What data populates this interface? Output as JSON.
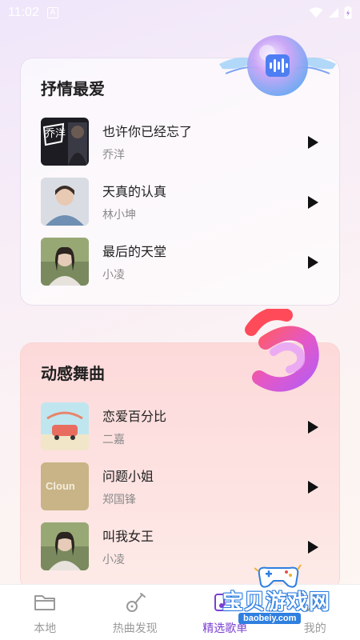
{
  "status": {
    "time": "11:02",
    "badge_letter": "A"
  },
  "sections": [
    {
      "title": "抒情最爱",
      "songs": [
        {
          "title": "也许你已经忘了",
          "artist": "乔洋",
          "cover_text": "乔洋"
        },
        {
          "title": "天真的认真",
          "artist": "林小坤"
        },
        {
          "title": "最后的天堂",
          "artist": "小凌"
        }
      ]
    },
    {
      "title": "动感舞曲",
      "songs": [
        {
          "title": "恋爱百分比",
          "artist": "二嘉"
        },
        {
          "title": "问题小姐",
          "artist": "郑国锋",
          "cover_text": "Cloun"
        },
        {
          "title": "叫我女王",
          "artist": "小凌"
        }
      ]
    }
  ],
  "tabs": [
    {
      "label": "本地",
      "icon": "folder-icon",
      "active": false
    },
    {
      "label": "热曲发现",
      "icon": "guitar-icon",
      "active": false
    },
    {
      "label": "精选歌单",
      "icon": "playlist-icon",
      "active": true
    },
    {
      "label": "我的",
      "icon": "user-icon",
      "active": false
    }
  ],
  "watermark": {
    "text": "宝贝游戏网",
    "url": "baobeiy.com"
  },
  "colors": {
    "accent": "#7a3fd1",
    "play": "#111111",
    "card2_bg": "#fdd9da"
  }
}
